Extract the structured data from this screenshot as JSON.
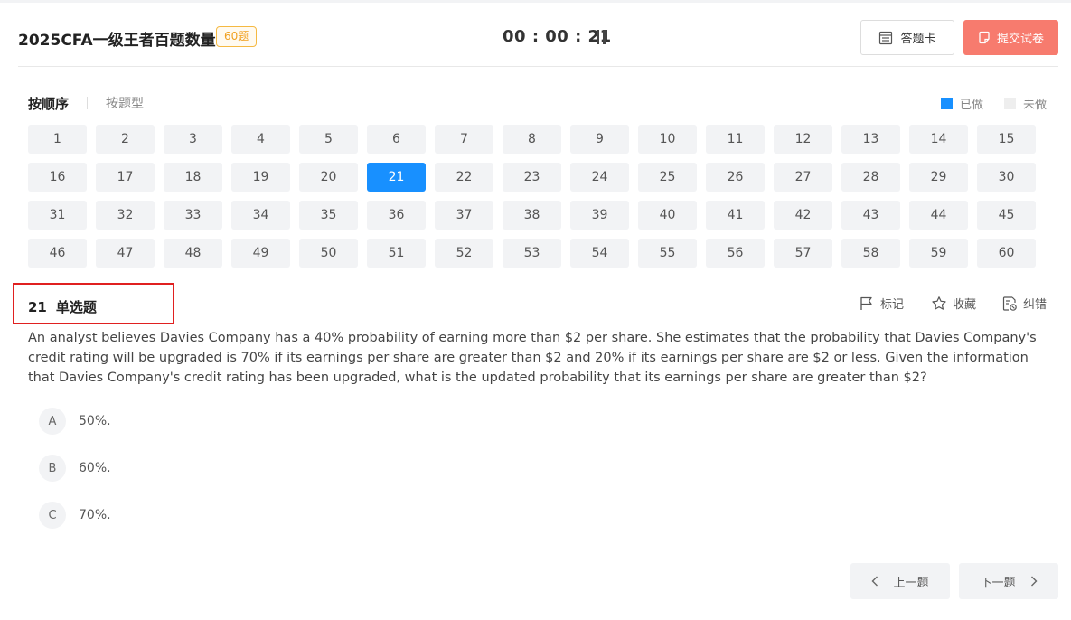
{
  "header": {
    "title": "2025CFA一级王者百题数量",
    "count_badge": "60题",
    "timer": "00 : 00 : 21",
    "answer_card_label": "答题卡",
    "submit_label": "提交试卷"
  },
  "tabs": {
    "order": "按顺序",
    "type": "按题型"
  },
  "legend": {
    "done": "已做",
    "undone": "未做",
    "done_color": "#1890ff",
    "undone_color": "#eeeeee"
  },
  "question_grid": {
    "current": 21,
    "numbers": [
      "1",
      "2",
      "3",
      "4",
      "5",
      "6",
      "7",
      "8",
      "9",
      "10",
      "11",
      "12",
      "13",
      "14",
      "15",
      "16",
      "17",
      "18",
      "19",
      "20",
      "21",
      "22",
      "23",
      "24",
      "25",
      "26",
      "27",
      "28",
      "29",
      "30",
      "31",
      "32",
      "33",
      "34",
      "35",
      "36",
      "37",
      "38",
      "39",
      "40",
      "41",
      "42",
      "43",
      "44",
      "45",
      "46",
      "47",
      "48",
      "49",
      "50",
      "51",
      "52",
      "53",
      "54",
      "55",
      "56",
      "57",
      "58",
      "59",
      "60"
    ]
  },
  "question": {
    "number": "21",
    "type": "单选题",
    "text": "An analyst believes Davies Company has a 40% probability of earning more than $2 per share. She estimates that the probability that Davies Company's credit rating will be upgraded is 70% if its earnings per share are greater than $2 and 20% if its earnings per share are $2 or less. Given the information that Davies Company's credit rating has been upgraded, what is the updated probability that its earnings per share are greater than $2?",
    "options": [
      {
        "letter": "A",
        "text": "50%."
      },
      {
        "letter": "B",
        "text": "60%."
      },
      {
        "letter": "C",
        "text": "70%."
      }
    ]
  },
  "tools": {
    "mark": "标记",
    "favorite": "收藏",
    "report_error": "纠错"
  },
  "nav": {
    "prev": "上一题",
    "next": "下一题"
  },
  "colors": {
    "accent": "#1890ff",
    "submit": "#f77b6e",
    "badge": "#f0a020",
    "highlight_box": "#e02020"
  }
}
